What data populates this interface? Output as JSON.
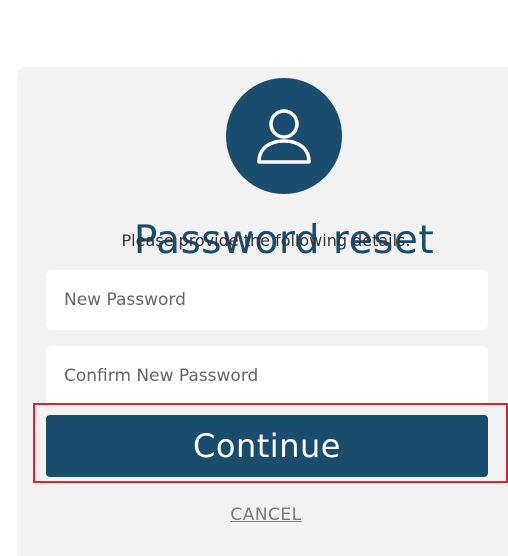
{
  "header": {
    "avatar_icon": "user-icon",
    "avatar_color": "#1a4c6e"
  },
  "form": {
    "title": "Password reset",
    "subtitle": "Please provide the following details.",
    "new_password": {
      "value": "",
      "placeholder": "New Password"
    },
    "confirm_password": {
      "value": "",
      "placeholder": "Confirm New Password"
    },
    "continue_label": "Continue",
    "cancel_label": "CANCEL"
  },
  "colors": {
    "accent": "#1a4c6e",
    "highlight_border": "#e0202e",
    "card_background": "#f2f2f2"
  }
}
